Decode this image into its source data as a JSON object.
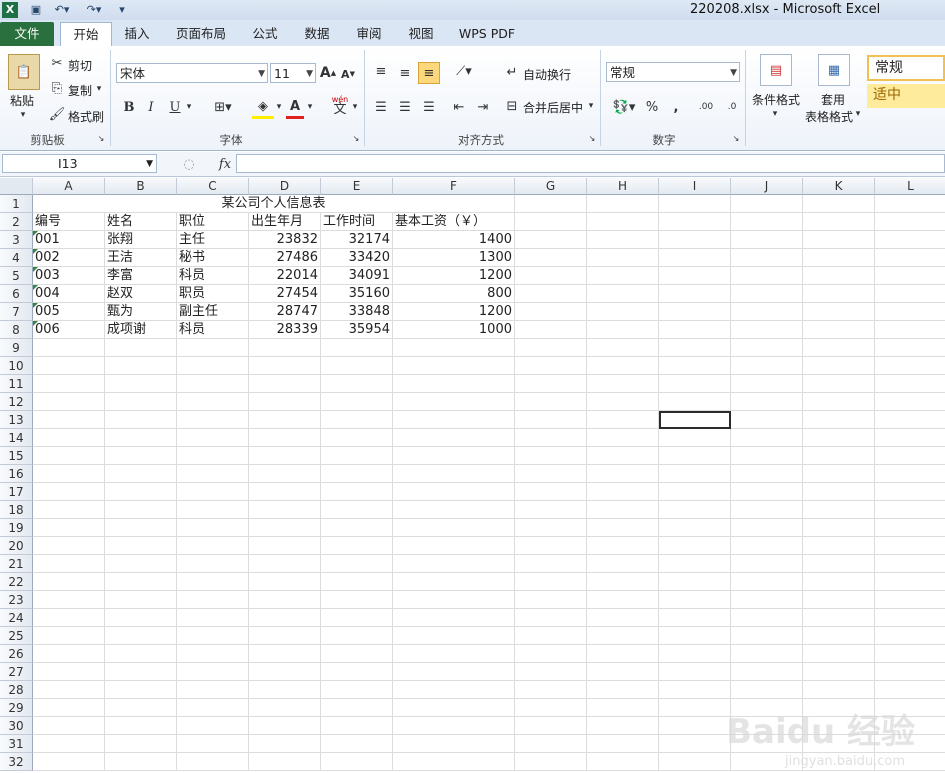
{
  "window": {
    "title": "220208.xlsx - Microsoft Excel"
  },
  "tabs": [
    "文件",
    "开始",
    "插入",
    "页面布局",
    "公式",
    "数据",
    "审阅",
    "视图",
    "WPS PDF"
  ],
  "ribbon": {
    "clipboard": {
      "paste": "粘贴",
      "cut": "剪切",
      "copy": "复制",
      "format_painter": "格式刷",
      "label": "剪贴板"
    },
    "font": {
      "name": "宋体",
      "size": "11",
      "bold": "B",
      "italic": "I",
      "underline": "U",
      "wen": "wén",
      "wen_char": "文",
      "label": "字体"
    },
    "alignment": {
      "wrap": "自动换行",
      "merge": "合并后居中",
      "label": "对齐方式"
    },
    "number": {
      "format": "常规",
      "percent": "%",
      "comma": ",",
      "inc_decimal": ".00",
      "dec_decimal": ".0",
      "label": "数字"
    },
    "styles": {
      "conditional": "条件格式",
      "table_line1": "套用",
      "table_line2": "表格格式",
      "style_normal": "常规",
      "style_neutral": "适中"
    }
  },
  "formula_bar": {
    "name_box": "I13",
    "fx": "fx",
    "value": ""
  },
  "columns": [
    "A",
    "B",
    "C",
    "D",
    "E",
    "F",
    "G",
    "H",
    "I",
    "J",
    "K",
    "L"
  ],
  "rows": [
    "1",
    "2",
    "3",
    "4",
    "5",
    "6",
    "7",
    "8",
    "9",
    "10",
    "11",
    "12",
    "13",
    "14",
    "15",
    "16",
    "17",
    "18",
    "19",
    "20",
    "21",
    "22",
    "23",
    "24",
    "25",
    "26",
    "27",
    "28",
    "29",
    "30",
    "31",
    "32"
  ],
  "sheet": {
    "title": "某公司个人信息表",
    "headers": [
      "编号",
      "姓名",
      "职位",
      "出生年月",
      "工作时间",
      "基本工资（￥）"
    ],
    "records": [
      [
        "001",
        "张翔",
        "主任",
        "23832",
        "32174",
        "1400"
      ],
      [
        "002",
        "王洁",
        "秘书",
        "27486",
        "33420",
        "1300"
      ],
      [
        "003",
        "李富",
        "科员",
        "22014",
        "34091",
        "1200"
      ],
      [
        "004",
        "赵双",
        "职员",
        "27454",
        "35160",
        "800"
      ],
      [
        "005",
        "甄为",
        "副主任",
        "28747",
        "33848",
        "1200"
      ],
      [
        "006",
        "成项谢",
        "科员",
        "28339",
        "35954",
        "1000"
      ]
    ]
  },
  "watermark": {
    "brand": "Baidu 经验",
    "url": "jingyan.baidu.com"
  },
  "colors": {
    "file_tab": "#2a6f3e",
    "ribbon_bg": "#eef3fa",
    "neutral_style": "#ffeb9c",
    "number_indicator": "#2b8a3e"
  }
}
